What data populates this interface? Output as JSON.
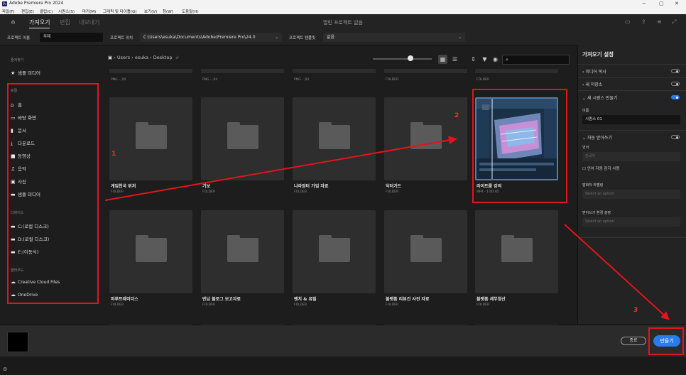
{
  "titlebar": {
    "logo": "Pr",
    "title": "Adobe Premiere Pro 2024",
    "min": "−",
    "max": "▢",
    "close": "✕"
  },
  "menubar": [
    "파일(F)",
    "편집(E)",
    "클립(C)",
    "시퀀스(S)",
    "마커(M)",
    "그래픽 및 타이틀(G)",
    "보기(V)",
    "창(W)",
    "도움말(H)"
  ],
  "tabs": {
    "home_icon": "home-icon",
    "import": "가져오기",
    "edit": "편집",
    "export": "내보내기",
    "center_title": "열린 프로젝트 없음"
  },
  "project": {
    "name_label": "프로젝트 이름",
    "name_value": "무제",
    "location_label": "프로젝트 위치",
    "location_value": "C:\\Users\\esuka\\Documents\\Adobe\\Premiere Pro\\24.0",
    "template_label": "프로젝트 템플릿",
    "template_value": "없음"
  },
  "sidebar": {
    "favorites_header": "즐겨찾기",
    "favorites": [
      {
        "icon": "star-icon",
        "label": "샘플 미디어"
      }
    ],
    "local_header": "로컬",
    "local": [
      {
        "icon": "home-icon",
        "label": "홈"
      },
      {
        "icon": "monitor-icon",
        "label": "바탕 화면"
      },
      {
        "icon": "document-icon",
        "label": "문서"
      },
      {
        "icon": "download-icon",
        "label": "다운로드"
      },
      {
        "icon": "video-icon",
        "label": "동영상"
      },
      {
        "icon": "music-icon",
        "label": "음악"
      },
      {
        "icon": "image-icon",
        "label": "사진"
      },
      {
        "icon": "folder-icon",
        "label": "샘플 미디어"
      }
    ],
    "devices_header": "디바이스",
    "devices": [
      {
        "icon": "drive-icon",
        "label": "C:(로컬 디스크)"
      },
      {
        "icon": "drive-icon",
        "label": "D:(로컬 디스크)"
      },
      {
        "icon": "drive-icon",
        "label": "E:(이동식)"
      }
    ],
    "cloud_header": "클라우드",
    "cloud": [
      {
        "icon": "cloud-icon",
        "label": "Creative Cloud Files"
      },
      {
        "icon": "cloud-icon",
        "label": "OneDrive"
      }
    ]
  },
  "browser": {
    "crumbs": [
      "Users",
      "esuka",
      "Desktop"
    ],
    "search_placeholder": "",
    "top_row_subs": [
      "PNG - ,04",
      "PNG - ,04",
      "PNG - ,04",
      "FOLDER",
      "FOLDER"
    ],
    "items": [
      {
        "name": "게임천국 위처",
        "sub": "FOLDER",
        "kind": "folder"
      },
      {
        "name": "기보",
        "sub": "FOLDER",
        "kind": "folder"
      },
      {
        "name": "나라장터 가입 자료",
        "sub": "FOLDER",
        "kind": "folder"
      },
      {
        "name": "닥터가드",
        "sub": "FOLDER",
        "kind": "folder"
      },
      {
        "name": "라이트룸 강의",
        "sub": "MP4 - 1:00:40",
        "kind": "video"
      },
      {
        "name": "마루트레이더스",
        "sub": "FOLDER",
        "kind": "folder"
      },
      {
        "name": "반납 블로그 보고자료",
        "sub": "FOLDER",
        "kind": "folder"
      },
      {
        "name": "벤치 & 유틸",
        "sub": "FOLDER",
        "kind": "folder"
      },
      {
        "name": "블랫폼 리뷰건 사진 자료",
        "sub": "FOLDER",
        "kind": "folder"
      },
      {
        "name": "블랫폼 세무정산",
        "sub": "FOLDER",
        "kind": "folder"
      }
    ]
  },
  "import_settings": {
    "title": "가져오기 설정",
    "copy_media": "미디어 복사",
    "new_bin": "새 저장소",
    "create_sequence": "새 시퀀스 만들기",
    "seq_name_label": "이름",
    "seq_name_value": "시퀀스 01",
    "auto_transcribe": "자동 받아쓰기",
    "language_label": "언어",
    "language_value": "한국어",
    "auto_detect": "언어 자동 감지 사용",
    "speaker_label": "발화자 라벨링",
    "speaker_value": "Select an option",
    "transcribe_label": "받아쓰기 환경 설정",
    "transcribe_value": "Select an option"
  },
  "footer": {
    "cancel": "종료",
    "create": "만들기"
  },
  "annotations": {
    "n1": "1",
    "n2": "2",
    "n3": "3"
  },
  "colors": {
    "accent": "#2a7bf0",
    "annotation": "#e3141b"
  }
}
